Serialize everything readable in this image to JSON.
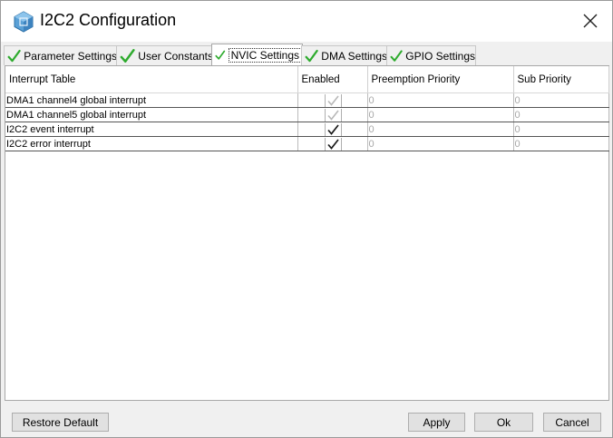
{
  "window": {
    "title": "I2C2 Configuration"
  },
  "tabs": [
    {
      "label": "Parameter Settings",
      "active": false
    },
    {
      "label": "User Constants",
      "active": false
    },
    {
      "label": "NVIC Settings",
      "active": true
    },
    {
      "label": "DMA Settings",
      "active": false
    },
    {
      "label": "GPIO Settings",
      "active": false
    }
  ],
  "table": {
    "headers": [
      "Interrupt Table",
      "Enabled",
      "Preemption Priority",
      "Sub Priority"
    ],
    "rows": [
      {
        "name": "DMA1 channel4 global interrupt",
        "enabled": true,
        "locked": true,
        "preemption": "0",
        "sub": "0"
      },
      {
        "name": "DMA1 channel5 global interrupt",
        "enabled": true,
        "locked": true,
        "preemption": "0",
        "sub": "0"
      },
      {
        "name": "I2C2 event interrupt",
        "enabled": true,
        "locked": false,
        "preemption": "0",
        "sub": "0"
      },
      {
        "name": "I2C2 error interrupt",
        "enabled": true,
        "locked": false,
        "preemption": "0",
        "sub": "0"
      }
    ]
  },
  "buttons": {
    "restore_default": "Restore Default",
    "apply": "Apply",
    "ok": "Ok",
    "cancel": "Cancel"
  },
  "colors": {
    "tab_check": "#2eab2e",
    "checkbox_enabled": "#1a1a1a",
    "checkbox_locked": "#b8b8b8",
    "app_icon": "#4a90c8"
  }
}
